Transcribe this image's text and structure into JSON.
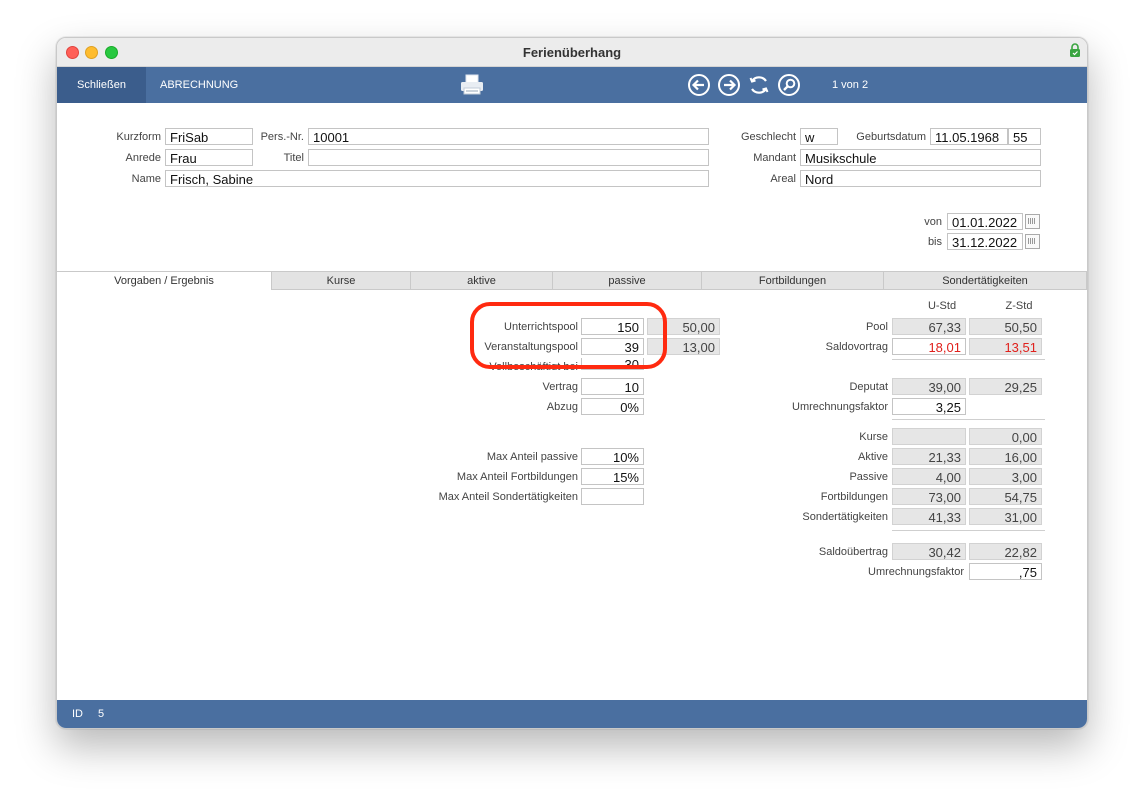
{
  "window": {
    "title": "Ferienüberhang"
  },
  "toolbar": {
    "close_label": "Schließen",
    "billing_label": "ABRECHNUNG",
    "record_counter": "1 von 2"
  },
  "person": {
    "kurzform_label": "Kurzform",
    "kurzform": "FriSab",
    "persnr_label": "Pers.-Nr.",
    "persnr": "10001",
    "anrede_label": "Anrede",
    "anrede": "Frau",
    "titel_label": "Titel",
    "titel": "",
    "name_label": "Name",
    "name": "Frisch, Sabine",
    "geschlecht_label": "Geschlecht",
    "geschlecht": "w",
    "geburtsdatum_label": "Geburtsdatum",
    "geburtsdatum": "11.05.1968",
    "alter": "55",
    "mandant_label": "Mandant",
    "mandant": "Musikschule",
    "areal_label": "Areal",
    "areal": "Nord",
    "von_label": "von",
    "von": "01.01.2022",
    "bis_label": "bis",
    "bis": "31.12.2022"
  },
  "tabs": [
    "Vorgaben / Ergebnis",
    "Kurse",
    "aktive",
    "passive",
    "Fortbildungen",
    "Sondertätigkeiten"
  ],
  "left": {
    "unterrichtspool_label": "Unterrichtspool",
    "unterrichtspool": "150",
    "unterrichtspool_calc": "50,00",
    "veranstaltungspool_label": "Veranstaltungspool",
    "veranstaltungspool": "39",
    "veranstaltungspool_calc": "13,00",
    "vollbeschaeftigt_label": "Vollbeschäftigt bei",
    "vollbeschaeftigt": "30",
    "vertrag_label": "Vertrag",
    "vertrag": "10",
    "abzug_label": "Abzug",
    "abzug": "0%",
    "max_passive_label": "Max Anteil passive",
    "max_passive": "10%",
    "max_fortbildungen_label": "Max Anteil Fortbildungen",
    "max_fortbildungen": "15%",
    "max_sonder_label": "Max Anteil Sondertätigkeiten",
    "max_sonder": ""
  },
  "right": {
    "col_u": "U-Std",
    "col_z": "Z-Std",
    "pool_label": "Pool",
    "pool_u": "67,33",
    "pool_z": "50,50",
    "saldovortrag_label": "Saldovortrag",
    "saldovortrag_u": "18,01",
    "saldovortrag_z": "13,51",
    "deputat_label": "Deputat",
    "deputat_u": "39,00",
    "deputat_z": "29,25",
    "umrechnung1_label": "Umrechnungsfaktor",
    "umrechnung1": "3,25",
    "kurse_label": "Kurse",
    "kurse_u": "",
    "kurse_z": "0,00",
    "aktive_label": "Aktive",
    "aktive_u": "21,33",
    "aktive_z": "16,00",
    "passive_label": "Passive",
    "passive_u": "4,00",
    "passive_z": "3,00",
    "fortbildungen_label": "Fortbildungen",
    "fortbildungen_u": "73,00",
    "fortbildungen_z": "54,75",
    "sonder_label": "Sondertätigkeiten",
    "sonder_u": "41,33",
    "sonder_z": "31,00",
    "saldouebertrag_label": "Saldoübertrag",
    "saldouebertrag_u": "30,42",
    "saldouebertrag_z": "22,82",
    "umrechnung2_label": "Umrechnungsfaktor",
    "umrechnung2": ",75"
  },
  "status": {
    "id_label": "ID",
    "id_value": "5"
  },
  "colors": {
    "toolbar": "#4a6fa0",
    "highlight": "#ff2a10",
    "negative_text": "#e0201c"
  },
  "icons": [
    "printer-icon",
    "arrow-left-icon",
    "arrow-right-icon",
    "refresh-icon",
    "search-icon",
    "lock-icon"
  ]
}
